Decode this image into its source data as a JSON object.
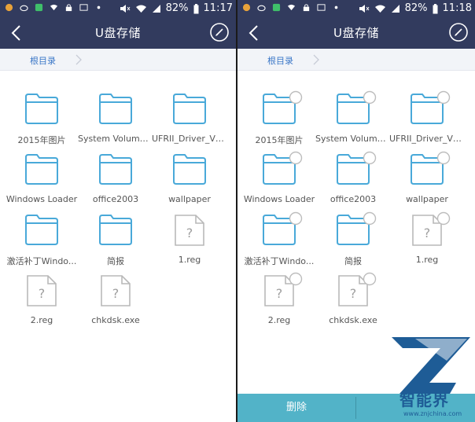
{
  "screens": [
    {
      "status": {
        "battery": "82%",
        "time": "11:17"
      },
      "header": {
        "title": "U盘存储"
      },
      "breadcrumb": {
        "root": "根目录"
      },
      "selection_mode": false,
      "items": [
        {
          "label": "2015年图片",
          "type": "folder",
          "col": 0,
          "row": 0
        },
        {
          "label": "System Volume I...",
          "type": "folder",
          "col": 1,
          "row": 0
        },
        {
          "label": "UFRII_Driver_V2...",
          "type": "folder",
          "col": 2,
          "row": 0
        },
        {
          "label": "Windows Loader",
          "type": "folder",
          "col": 0,
          "row": 1
        },
        {
          "label": "office2003",
          "type": "folder",
          "col": 1,
          "row": 1
        },
        {
          "label": "wallpaper",
          "type": "folder",
          "col": 2,
          "row": 1
        },
        {
          "label": "激活补丁Windo...",
          "type": "folder",
          "col": 0,
          "row": 2
        },
        {
          "label": "简报",
          "type": "folder",
          "col": 1,
          "row": 2
        },
        {
          "label": "1.reg",
          "type": "file",
          "col": 2,
          "row": 2
        },
        {
          "label": "2.reg",
          "type": "file",
          "col": 0,
          "row": 3
        },
        {
          "label": "chkdsk.exe",
          "type": "file",
          "col": 1,
          "row": 3
        }
      ]
    },
    {
      "status": {
        "battery": "82%",
        "time": "11:18"
      },
      "header": {
        "title": "U盘存储"
      },
      "breadcrumb": {
        "root": "根目录"
      },
      "selection_mode": true,
      "bottom_bar": {
        "delete_label": "删除"
      },
      "items": [
        {
          "label": "2015年图片",
          "type": "folder",
          "col": 0,
          "row": 0
        },
        {
          "label": "System Volume I...",
          "type": "folder",
          "col": 1,
          "row": 0
        },
        {
          "label": "UFRII_Driver_V2...",
          "type": "folder",
          "col": 2,
          "row": 0
        },
        {
          "label": "Windows Loader",
          "type": "folder",
          "col": 0,
          "row": 1
        },
        {
          "label": "office2003",
          "type": "folder",
          "col": 1,
          "row": 1
        },
        {
          "label": "wallpaper",
          "type": "folder",
          "col": 2,
          "row": 1
        },
        {
          "label": "激活补丁Windo...",
          "type": "folder",
          "col": 0,
          "row": 2
        },
        {
          "label": "简报",
          "type": "folder",
          "col": 1,
          "row": 2
        },
        {
          "label": "1.reg",
          "type": "file",
          "col": 2,
          "row": 2
        },
        {
          "label": "2.reg",
          "type": "file",
          "col": 0,
          "row": 3
        },
        {
          "label": "chkdsk.exe",
          "type": "file",
          "col": 1,
          "row": 3
        }
      ]
    }
  ],
  "watermark": {
    "brand": "智能界",
    "url": "www.znjchina.com"
  },
  "colors": {
    "header": "#323b5e",
    "folder": "#49a9d9",
    "accent": "#3b77c7",
    "bottom_bar": "#52b3c8"
  }
}
